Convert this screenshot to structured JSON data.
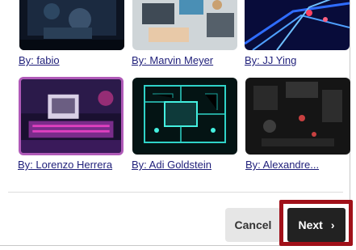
{
  "gallery": {
    "credits": [
      "By: fabio",
      "By: Marvin Meyer",
      "By: JJ Ying",
      "By: Lorenzo Herrera",
      "By: Adi Goldstein",
      "By: Alexandre..."
    ],
    "images": [
      {
        "icon": "city-night-image"
      },
      {
        "icon": "laptops-desk-image"
      },
      {
        "icon": "blue-network-image"
      },
      {
        "icon": "retro-computer-image"
      },
      {
        "icon": "circuit-board-image"
      },
      {
        "icon": "motherboard-image"
      }
    ],
    "selected_index": 3,
    "selected_border_color": "#b05ab8"
  },
  "footer": {
    "cancel_label": "Cancel",
    "next_label": "Next",
    "next_icon": "chevron-right-icon",
    "highlight_color": "#a01019"
  }
}
